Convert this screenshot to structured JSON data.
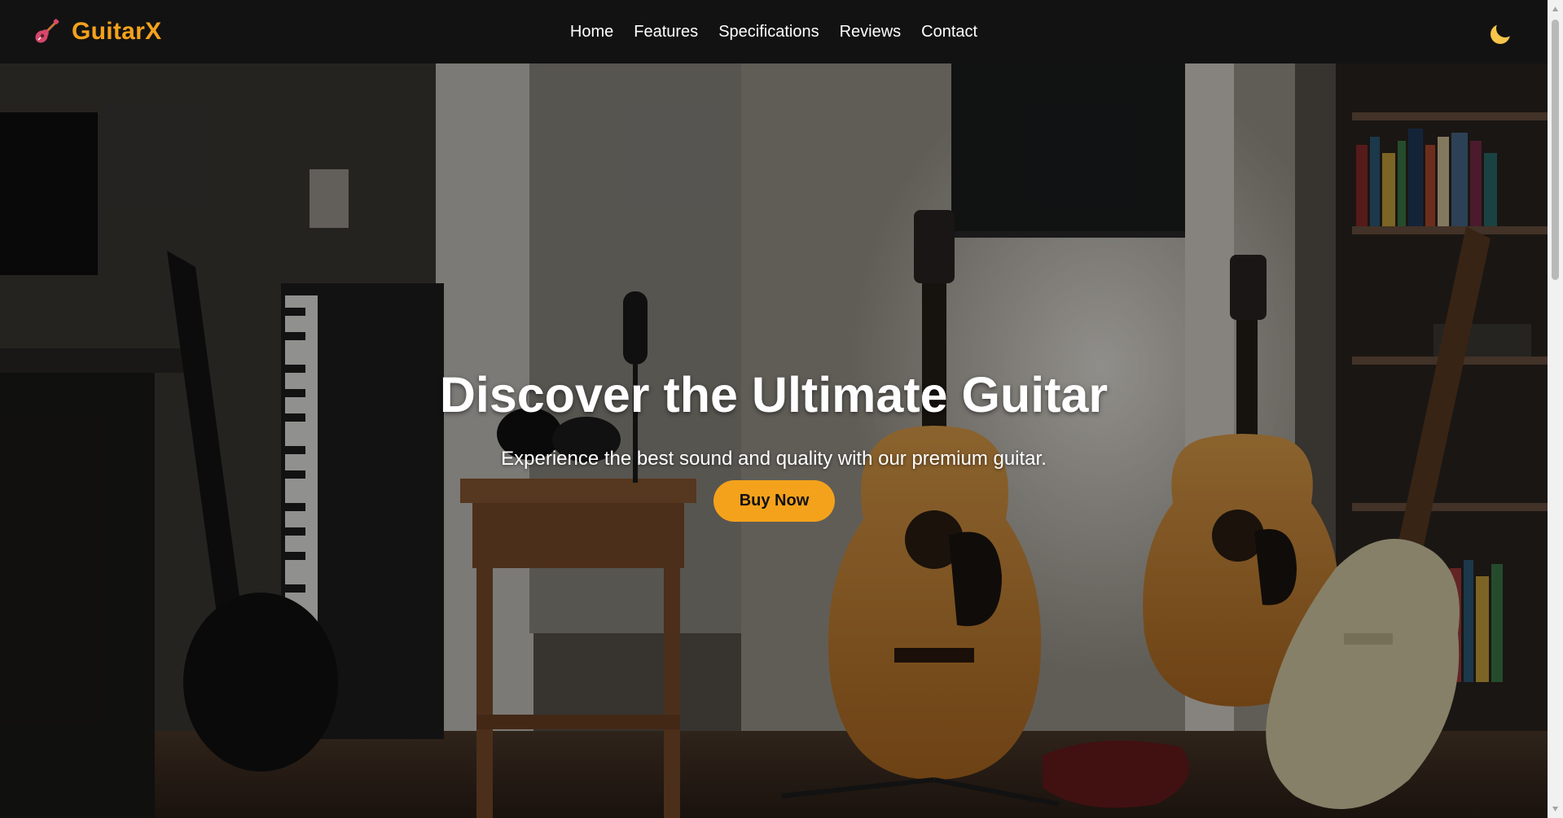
{
  "brand": {
    "name": "GuitarX",
    "icon": "guitar-icon",
    "color": "#f4a21c"
  },
  "nav": {
    "items": [
      {
        "label": "Home"
      },
      {
        "label": "Features"
      },
      {
        "label": "Specifications"
      },
      {
        "label": "Reviews"
      },
      {
        "label": "Contact"
      }
    ],
    "theme_toggle_icon": "moon-icon"
  },
  "hero": {
    "title": "Discover the Ultimate Guitar",
    "subtitle": "Experience the best sound and quality with our premium guitar.",
    "cta_label": "Buy Now",
    "background": "music-room-with-guitars-photo"
  },
  "colors": {
    "accent": "#f4a21c",
    "navbar": "#121212",
    "text": "#ffffff"
  }
}
